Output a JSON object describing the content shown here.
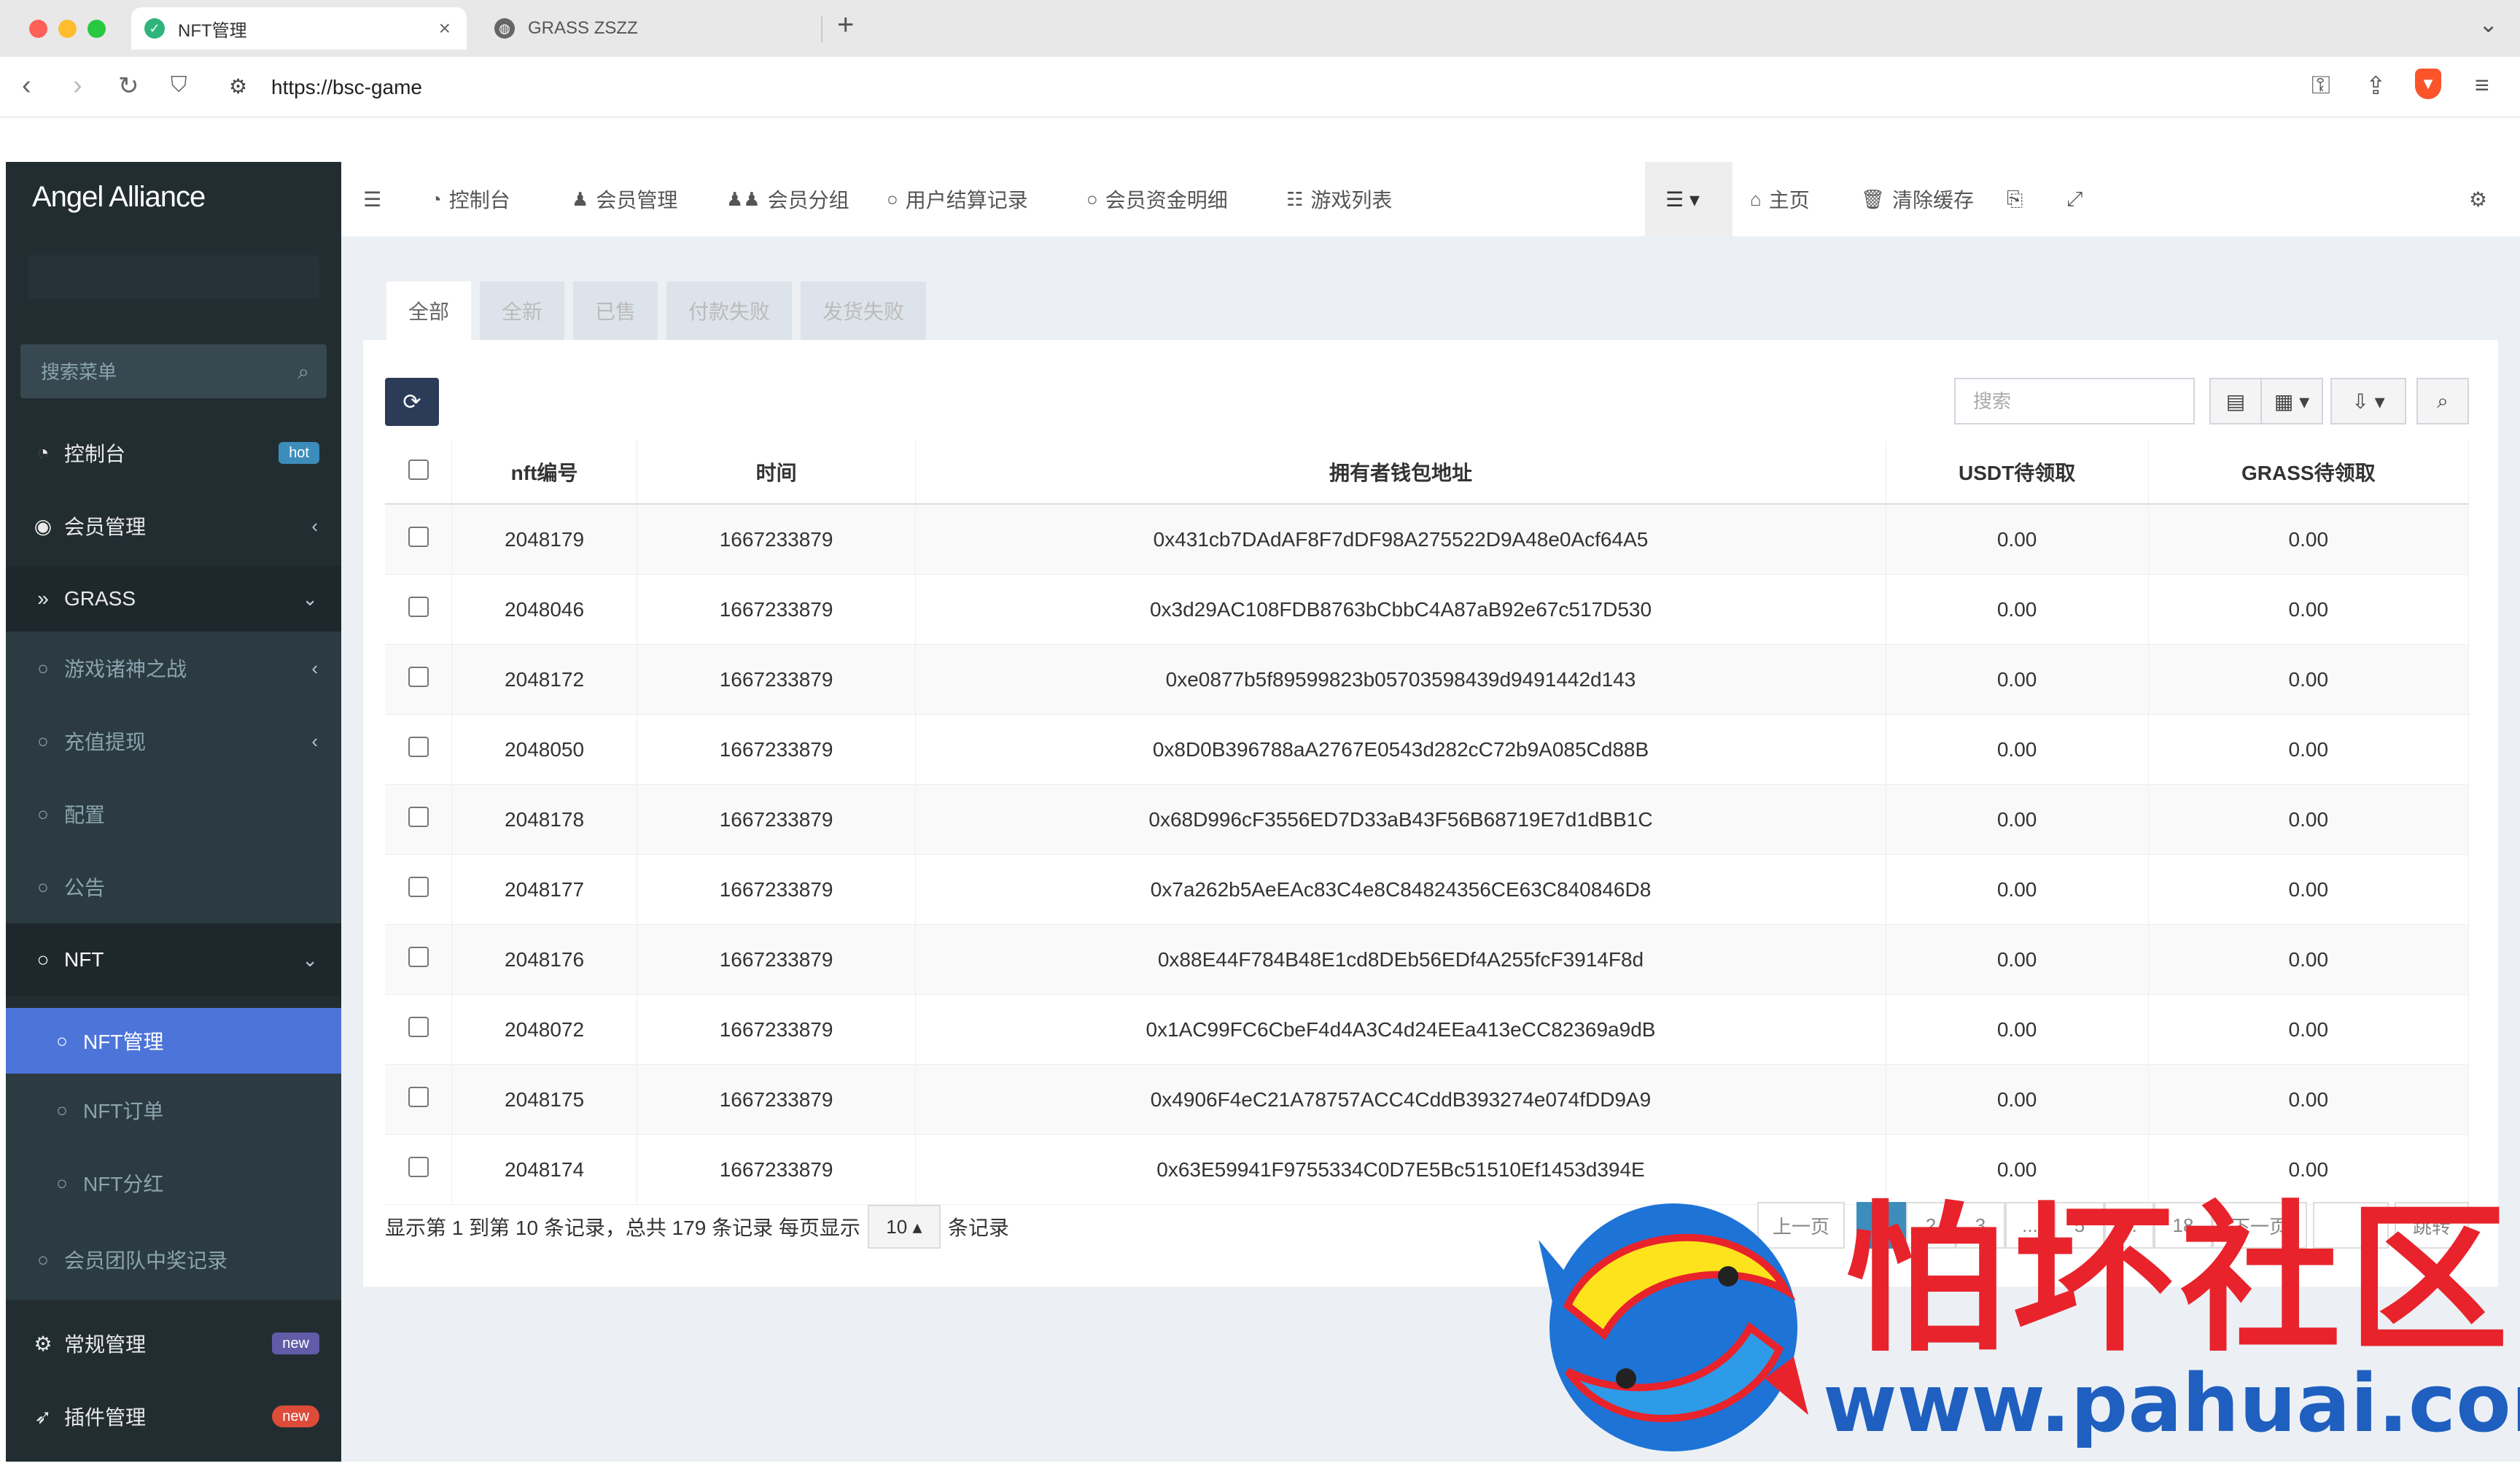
{
  "browser": {
    "tabs": [
      {
        "title": "NFT管理",
        "active": true
      },
      {
        "title": "GRASS ZSZZ",
        "active": false
      }
    ],
    "url": "https://bsc-game"
  },
  "sidebar": {
    "brand": "Angel Alliance",
    "search_placeholder": "搜索菜单",
    "items": [
      {
        "label": "控制台",
        "icon": "dashboard-icon",
        "badge": "hot"
      },
      {
        "label": "会员管理",
        "icon": "user-circle-icon",
        "arrow": "‹"
      },
      {
        "label": "GRASS",
        "icon": "double-chevron-icon",
        "arrow": "⌄"
      },
      {
        "label": "游戏诸神之战",
        "icon": "circle-icon",
        "arrow": "‹"
      },
      {
        "label": "充值提现",
        "icon": "circle-icon",
        "arrow": "‹"
      },
      {
        "label": "配置",
        "icon": "circle-icon"
      },
      {
        "label": "公告",
        "icon": "circle-icon"
      },
      {
        "label": "NFT",
        "icon": "circle-icon",
        "arrow": "⌄"
      },
      {
        "label": "NFT管理",
        "icon": "circle-icon"
      },
      {
        "label": "NFT订单",
        "icon": "circle-icon"
      },
      {
        "label": "NFT分红",
        "icon": "circle-icon"
      },
      {
        "label": "会员团队中奖记录",
        "icon": "circle-icon"
      },
      {
        "label": "常规管理",
        "icon": "cogs-icon",
        "badge": "new"
      },
      {
        "label": "插件管理",
        "icon": "rocket-icon",
        "badge": "new"
      }
    ]
  },
  "topnav": {
    "items": [
      {
        "label": "控制台",
        "icon": "dashboard-icon"
      },
      {
        "label": "会员管理",
        "icon": "user-icon"
      },
      {
        "label": "会员分组",
        "icon": "users-icon"
      },
      {
        "label": "用户结算记录",
        "icon": "circle-icon"
      },
      {
        "label": "会员资金明细",
        "icon": "circle-icon"
      },
      {
        "label": "游戏列表",
        "icon": "list-icon"
      }
    ],
    "right": [
      {
        "label": "主页",
        "icon": "home-icon"
      },
      {
        "label": "清除缓存",
        "icon": "trash-icon"
      }
    ]
  },
  "filter_tabs": [
    "全部",
    "全新",
    "已售",
    "付款失败",
    "发货失败"
  ],
  "toolbar": {
    "search_placeholder": "搜索"
  },
  "table": {
    "columns": [
      "nft编号",
      "时间",
      "拥有者钱包地址",
      "USDT待领取",
      "GRASS待领取"
    ],
    "rows": [
      [
        "2048179",
        "1667233879",
        "0x431cb7DAdAF8F7dDF98A275522D9A48e0Acf64A5",
        "0.00",
        "0.00"
      ],
      [
        "2048046",
        "1667233879",
        "0x3d29AC108FDB8763bCbbC4A87aB92e67c517D530",
        "0.00",
        "0.00"
      ],
      [
        "2048172",
        "1667233879",
        "0xe0877b5f89599823b05703598439d9491442d143",
        "0.00",
        "0.00"
      ],
      [
        "2048050",
        "1667233879",
        "0x8D0B396788aA2767E0543d282cC72b9A085Cd88B",
        "0.00",
        "0.00"
      ],
      [
        "2048178",
        "1667233879",
        "0x68D996cF3556ED7D33aB43F56B68719E7d1dBB1C",
        "0.00",
        "0.00"
      ],
      [
        "2048177",
        "1667233879",
        "0x7a262b5AeEAc83C4e8C84824356CE63C840846D8",
        "0.00",
        "0.00"
      ],
      [
        "2048176",
        "1667233879",
        "0x88E44F784B48E1cd8DEb56EDf4A255fcF3914F8d",
        "0.00",
        "0.00"
      ],
      [
        "2048072",
        "1667233879",
        "0x1AC99FC6CbeF4d4A3C4d24EEa413eCC82369a9dB",
        "0.00",
        "0.00"
      ],
      [
        "2048175",
        "1667233879",
        "0x4906F4eC21A78757ACC4CddB393274e074fDD9A9",
        "0.00",
        "0.00"
      ],
      [
        "2048174",
        "1667233879",
        "0x63E59941F9755334C0D7E5Bc51510Ef1453d394E",
        "0.00",
        "0.00"
      ]
    ]
  },
  "pagination": {
    "info_prefix": "显示第 1 到第 10 条记录，总共 179 条记录 每页显示",
    "page_size": "10",
    "info_suffix": "条记录",
    "prev": "上一页",
    "pages": [
      "1",
      "2",
      "3",
      "...",
      "5",
      "...",
      "18"
    ],
    "next": "下一页",
    "jump": "跳转"
  },
  "watermark": {
    "text": "怕坏社区",
    "url": "www.pahuai.com"
  },
  "colors": {
    "sidebar_bg": "#222d32",
    "active_item": "#4d74d8",
    "content_bg": "#ecf0f5",
    "watermark_red": "#e8232b",
    "watermark_blue": "#1f5fbf"
  }
}
